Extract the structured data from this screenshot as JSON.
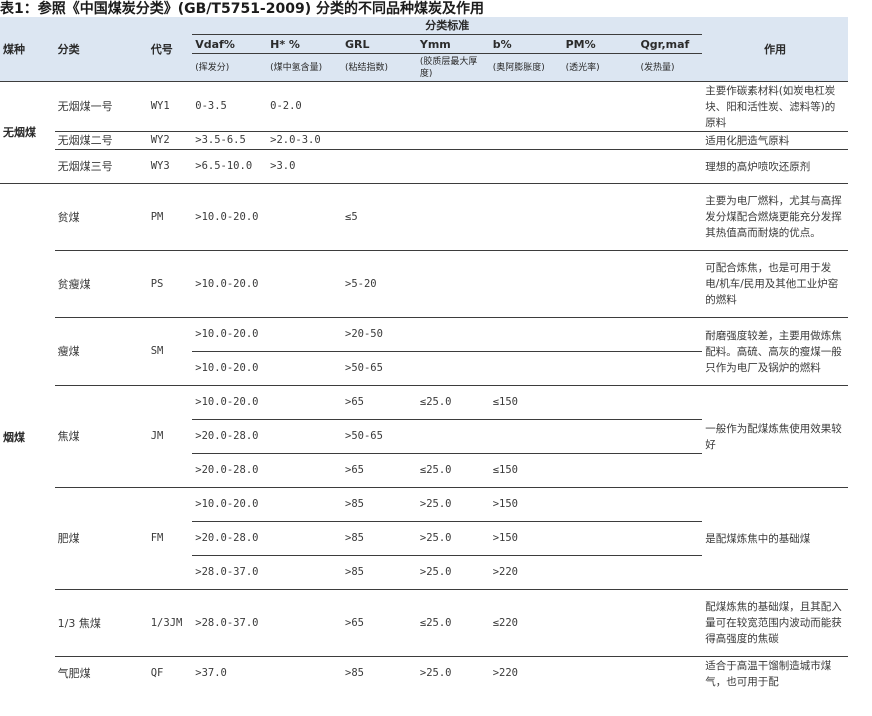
{
  "title": "表1：参照《中国煤炭分类》(GB/T5751-2009) 分类的不同品种煤炭及作用",
  "header": {
    "coal_type": "煤种",
    "category": "分类",
    "code": "代号",
    "criteria": "分类标准",
    "usage": "作用",
    "columns": [
      "Vdaf%",
      "H* %",
      "GRL",
      "Ymm",
      "b%",
      "PM%",
      "Qgr,maf"
    ],
    "column_notes": [
      "(挥发分)",
      "(煤中氢含量)",
      "(粘结指数)",
      "(胶质层最大厚度)",
      "(奥阿膨胀度)",
      "(透光率)",
      "(发热量)"
    ]
  },
  "groups": [
    {
      "coal_type": "无烟煤",
      "rows": [
        {
          "category": "无烟煤一号",
          "code": "WY1",
          "vdaf": "0-3.5",
          "h": "0-2.0",
          "grl": "",
          "ymm": "",
          "b": "",
          "pm": "",
          "qgr": "",
          "usage": "主要作碳素材料(如炭电杠炭块、阳和活性炭、滤料等)的原料"
        },
        {
          "category": "无烟煤二号",
          "code": "WY2",
          "vdaf": ">3.5-6.5",
          "h": ">2.0-3.0",
          "grl": "",
          "ymm": "",
          "b": "",
          "pm": "",
          "qgr": "",
          "usage": "适用化肥造气原料"
        },
        {
          "category": "无烟煤三号",
          "code": "WY3",
          "vdaf": ">6.5-10.0",
          "h": ">3.0",
          "grl": "",
          "ymm": "",
          "b": "",
          "pm": "",
          "qgr": "",
          "usage": "理想的高炉喷吹还原剂"
        }
      ]
    },
    {
      "coal_type": "烟煤",
      "categories": [
        {
          "category": "贫煤",
          "code": "PM",
          "usage": "主要为电厂燃料，尤其与高挥发分煤配合燃烧更能充分发挥其热值高而耐烧的优点。",
          "rows": [
            {
              "vdaf": ">10.0-20.0",
              "grl": "≤5",
              "ymm": "",
              "b": ""
            }
          ]
        },
        {
          "category": "贫瘦煤",
          "code": "PS",
          "usage": "可配合炼焦，也是可用于发电/机车/民用及其他工业炉窑的燃料",
          "rows": [
            {
              "vdaf": ">10.0-20.0",
              "grl": ">5-20",
              "ymm": "",
              "b": ""
            }
          ]
        },
        {
          "category": "瘦煤",
          "code": "SM",
          "usage": "耐磨强度较差，主要用做炼焦配料。高硫、高灰的瘦煤一般只作为电厂及锅炉的燃料",
          "rows": [
            {
              "vdaf": ">10.0-20.0",
              "grl": ">20-50",
              "ymm": "",
              "b": ""
            },
            {
              "vdaf": ">10.0-20.0",
              "grl": ">50-65",
              "ymm": "",
              "b": ""
            }
          ]
        },
        {
          "category": "焦煤",
          "code": "JM",
          "usage": "一般作为配煤炼焦使用效果较好",
          "rows": [
            {
              "vdaf": ">10.0-20.0",
              "grl": ">65",
              "ymm": "≤25.0",
              "b": "≤150"
            },
            {
              "vdaf": ">20.0-28.0",
              "grl": ">50-65",
              "ymm": "",
              "b": ""
            },
            {
              "vdaf": ">20.0-28.0",
              "grl": ">65",
              "ymm": "≤25.0",
              "b": "≤150"
            }
          ]
        },
        {
          "category": "肥煤",
          "code": "FM",
          "usage": "是配煤炼焦中的基础煤",
          "rows": [
            {
              "vdaf": ">10.0-20.0",
              "grl": ">85",
              "ymm": ">25.0",
              "b": ">150"
            },
            {
              "vdaf": ">20.0-28.0",
              "grl": ">85",
              "ymm": ">25.0",
              "b": ">150"
            },
            {
              "vdaf": ">28.0-37.0",
              "grl": ">85",
              "ymm": ">25.0",
              "b": ">220"
            }
          ]
        },
        {
          "category": "1/3 焦煤",
          "code": "1/3JM",
          "usage": "配煤炼焦的基础煤，且其配入量可在较宽范围内波动而能获得高强度的焦碳",
          "rows": [
            {
              "vdaf": ">28.0-37.0",
              "grl": ">65",
              "ymm": "≤25.0",
              "b": "≤220"
            }
          ]
        },
        {
          "category": "气肥煤",
          "code": "QF",
          "usage": "适合于高温干馏制造城市煤气，也可用于配",
          "rows": [
            {
              "vdaf": ">37.0",
              "grl": ">85",
              "ymm": ">25.0",
              "b": ">220"
            }
          ]
        }
      ]
    }
  ],
  "colors": {
    "header_bg": "#dce6f2",
    "rule": "#3d3d3d"
  }
}
